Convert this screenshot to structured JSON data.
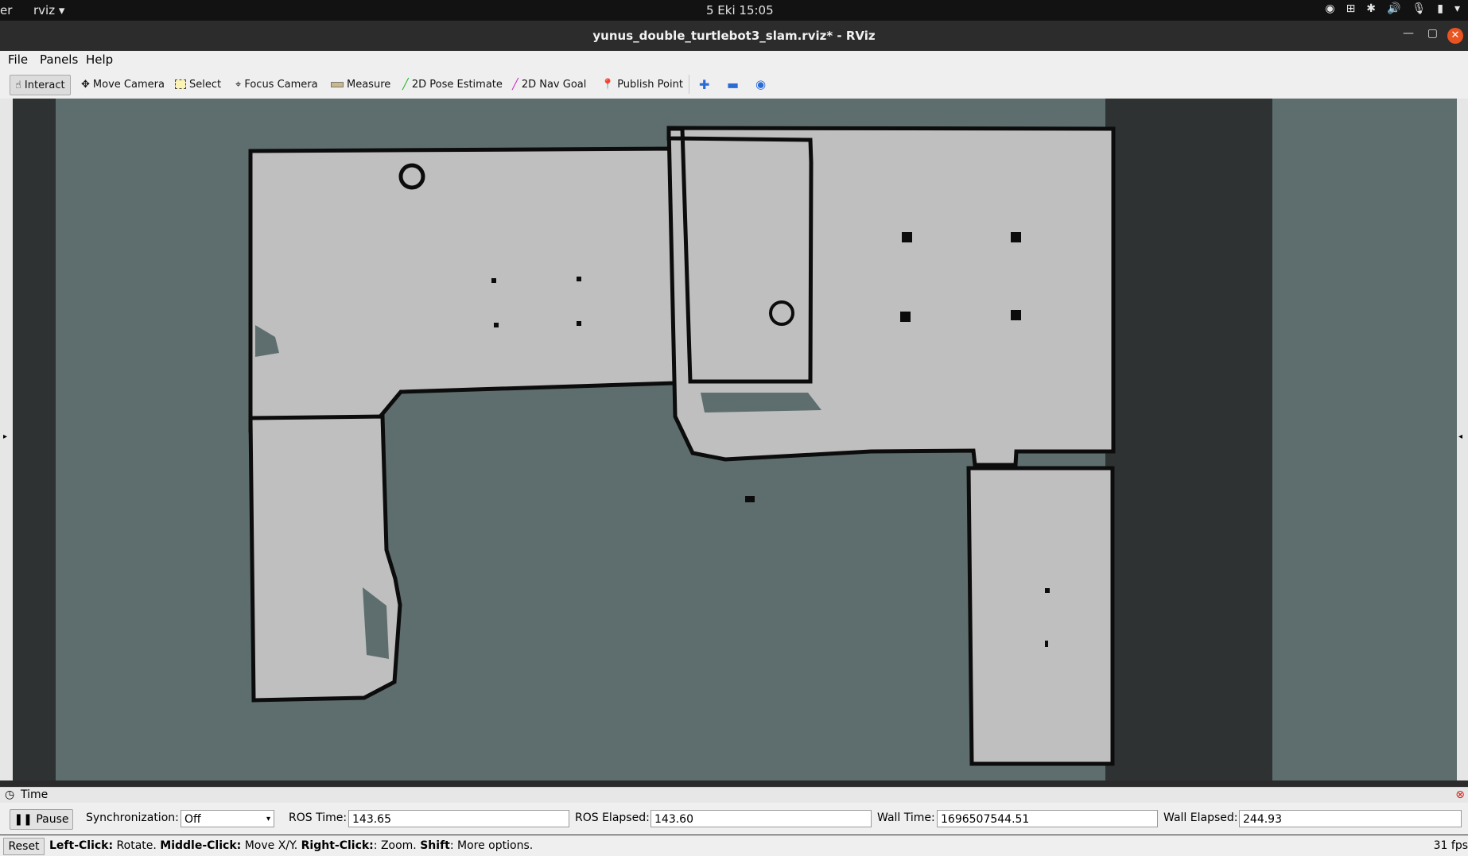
{
  "topbar": {
    "left_fragment": "er",
    "app": "rviz ▾",
    "clock": "5 Eki  15:05"
  },
  "window": {
    "title": "yunus_double_turtlebot3_slam.rviz* - RViz"
  },
  "menu": {
    "file": "File",
    "panels": "Panels",
    "help": "Help"
  },
  "toolbar": {
    "interact": "Interact",
    "move_camera": "Move Camera",
    "select": "Select",
    "focus_camera": "Focus Camera",
    "measure": "Measure",
    "pose_estimate": "2D Pose Estimate",
    "nav_goal": "2D Nav Goal",
    "publish_point": "Publish Point"
  },
  "time_panel": {
    "header": "Time",
    "pause": "Pause",
    "sync_label": "Synchronization:",
    "sync_value": "Off",
    "ros_time_label": "ROS Time:",
    "ros_time": "143.65",
    "ros_elapsed_label": "ROS Elapsed:",
    "ros_elapsed": "143.60",
    "wall_time_label": "Wall Time:",
    "wall_time": "1696507544.51",
    "wall_elapsed_label": "Wall Elapsed:",
    "wall_elapsed": "244.93"
  },
  "status": {
    "reset": "Reset",
    "left_click": "Left-Click:",
    "left_text": " Rotate. ",
    "middle_click": "Middle-Click:",
    "middle_text": " Move X/Y. ",
    "right_click": "Right-Click:",
    "right_text": ": Zoom. ",
    "shift": "Shift",
    "shift_text": ": More options.",
    "fps": "31 fps"
  },
  "colors": {
    "unknown": "#5e6e6e",
    "free": "#bfbfbf",
    "wall": "#0c0c0c",
    "accent": "#e95420"
  }
}
